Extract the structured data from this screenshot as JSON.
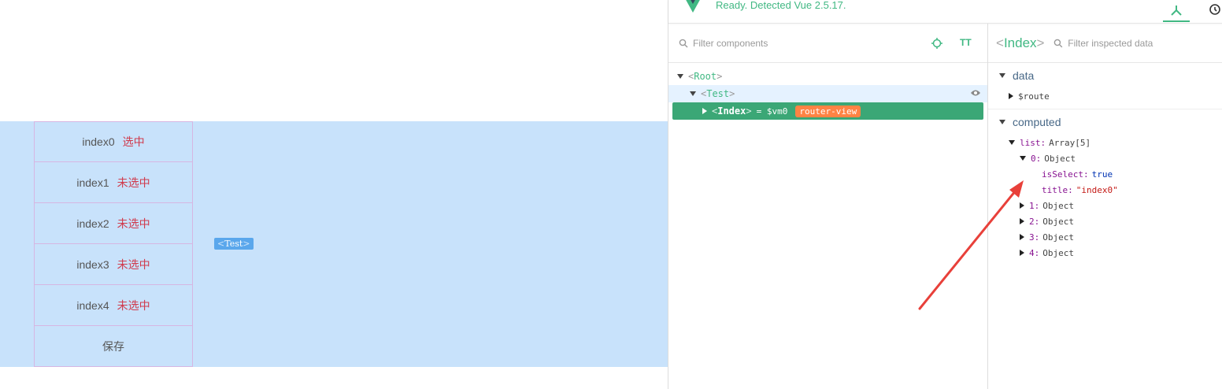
{
  "app": {
    "items": [
      {
        "title": "index0",
        "state": "选中"
      },
      {
        "title": "index1",
        "state": "未选中"
      },
      {
        "title": "index2",
        "state": "未选中"
      },
      {
        "title": "index3",
        "state": "未选中"
      },
      {
        "title": "index4",
        "state": "未选中"
      }
    ],
    "save_label": "保存",
    "overlay_tag": "Test"
  },
  "devtools": {
    "status": "Ready. Detected Vue 2.5.17.",
    "filter_components_placeholder": "Filter components",
    "filter_inspected_placeholder": "Filter inspected data",
    "tree": {
      "root": "Root",
      "test": "Test",
      "index": "Index",
      "index_vm": "= $vm0",
      "index_badge": "router-view"
    },
    "inspected": {
      "component": "Index",
      "data_section": "data",
      "data_props": [
        {
          "key": "$route"
        }
      ],
      "computed_section": "computed",
      "list_key": "list:",
      "list_val": "Array[5]",
      "obj0_key": "0:",
      "obj0_val": "Object",
      "is_select_key": "isSelect:",
      "is_select_val": "true",
      "title_key": "title:",
      "title_val": "\"index0\"",
      "collapsed_objects": [
        {
          "key": "1:",
          "val": "Object"
        },
        {
          "key": "2:",
          "val": "Object"
        },
        {
          "key": "3:",
          "val": "Object"
        },
        {
          "key": "4:",
          "val": "Object"
        }
      ]
    },
    "colors": {
      "vue_green": "#41b883",
      "selected_row": "#3ba776",
      "badge_orange": "#ff8344",
      "annotation_red": "#e8403a"
    }
  }
}
